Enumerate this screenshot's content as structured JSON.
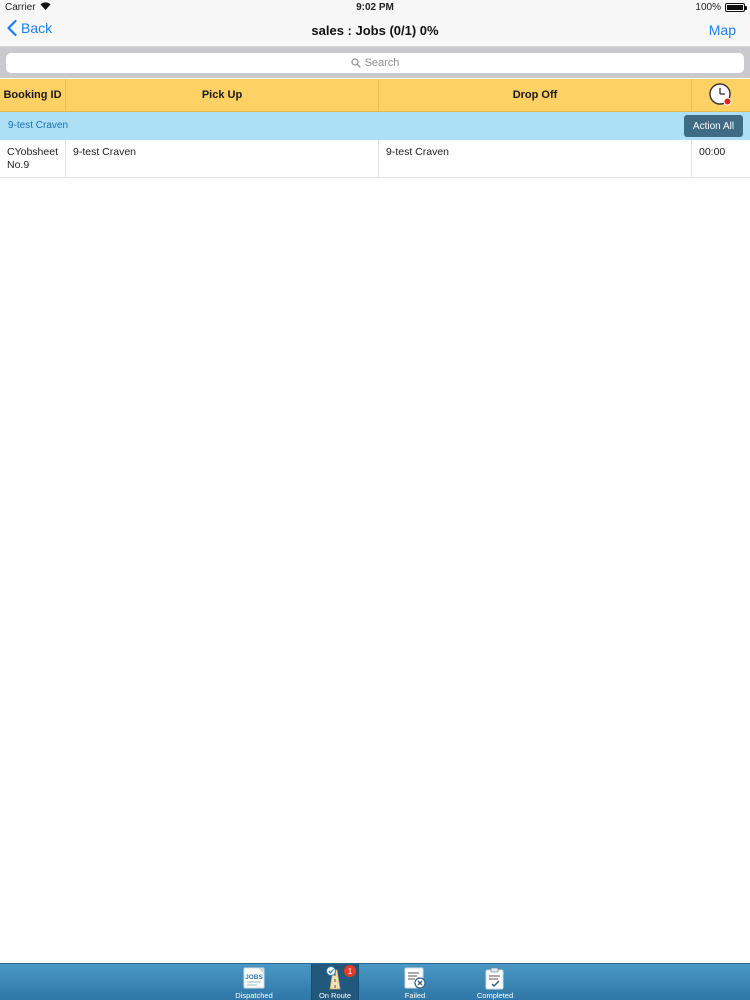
{
  "status_bar": {
    "carrier": "Carrier",
    "time": "9:02 PM",
    "battery": "100%",
    "battery_level": 1.0
  },
  "nav": {
    "back_label": "Back",
    "title": "sales : Jobs (0/1) 0%",
    "map_label": "Map"
  },
  "search": {
    "placeholder": "Search"
  },
  "table": {
    "headers": {
      "booking_id": "Booking ID",
      "pick_up": "Pick Up",
      "drop_off": "Drop Off",
      "time_icon": "clock-icon"
    },
    "group": {
      "label": "9-test Craven",
      "action_label": "Action All"
    },
    "rows": [
      {
        "booking_id": "CYobsheetNo.9",
        "pick_up": "9-test Craven",
        "drop_off": "9-test Craven",
        "time": "00:00"
      }
    ]
  },
  "tab_bar": {
    "tabs": [
      {
        "label": "Dispatched",
        "icon": "jobs-icon",
        "icon_text": "JOBS",
        "active": false
      },
      {
        "label": "On Route",
        "icon": "on-route-icon",
        "badge": "1",
        "active": true
      },
      {
        "label": "Failed",
        "icon": "failed-icon",
        "active": false
      },
      {
        "label": "Completed",
        "icon": "completed-icon",
        "active": false
      }
    ]
  },
  "colors": {
    "accent": "#1a7ef0",
    "header_bg": "#fdd163",
    "group_bg": "#aee0f5",
    "action_button": "#3f6b84",
    "tab_bar": "#2e77a7",
    "badge": "#e23b2e"
  }
}
